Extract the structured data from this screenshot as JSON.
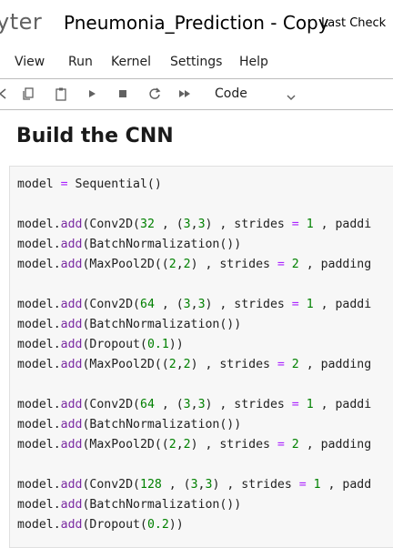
{
  "app": {
    "logo_text": "yter",
    "notebook_title": "Pneumonia_Prediction - Copy",
    "checkpoint": "Last Check"
  },
  "menu": [
    "View",
    "Run",
    "Kernel",
    "Settings",
    "Help"
  ],
  "toolbar": {
    "icons": [
      "cut-icon",
      "copy-icon",
      "paste-icon",
      "run-icon",
      "stop-icon",
      "restart-icon",
      "run-all-icon"
    ],
    "cell_type": "Code"
  },
  "markdown": {
    "heading": "Build the CNN"
  },
  "code_lines": [
    "model = Sequential()",
    "",
    "model.add(Conv2D(32 , (3,3) , strides = 1 , paddi",
    "model.add(BatchNormalization())",
    "model.add(MaxPool2D((2,2) , strides = 2 , padding",
    "",
    "model.add(Conv2D(64 , (3,3) , strides = 1 , paddi",
    "model.add(BatchNormalization())",
    "model.add(Dropout(0.1))",
    "model.add(MaxPool2D((2,2) , strides = 2 , padding",
    "",
    "model.add(Conv2D(64 , (3,3) , strides = 1 , paddi",
    "model.add(BatchNormalization())",
    "model.add(MaxPool2D((2,2) , strides = 2 , padding",
    "",
    "model.add(Conv2D(128 , (3,3) , strides = 1 , padd",
    "model.add(BatchNormalization())",
    "model.add(Dropout(0.2))"
  ],
  "colors": {
    "operator": "#aa22ff",
    "number": "#008000",
    "code_background": "#f7f7f7"
  }
}
